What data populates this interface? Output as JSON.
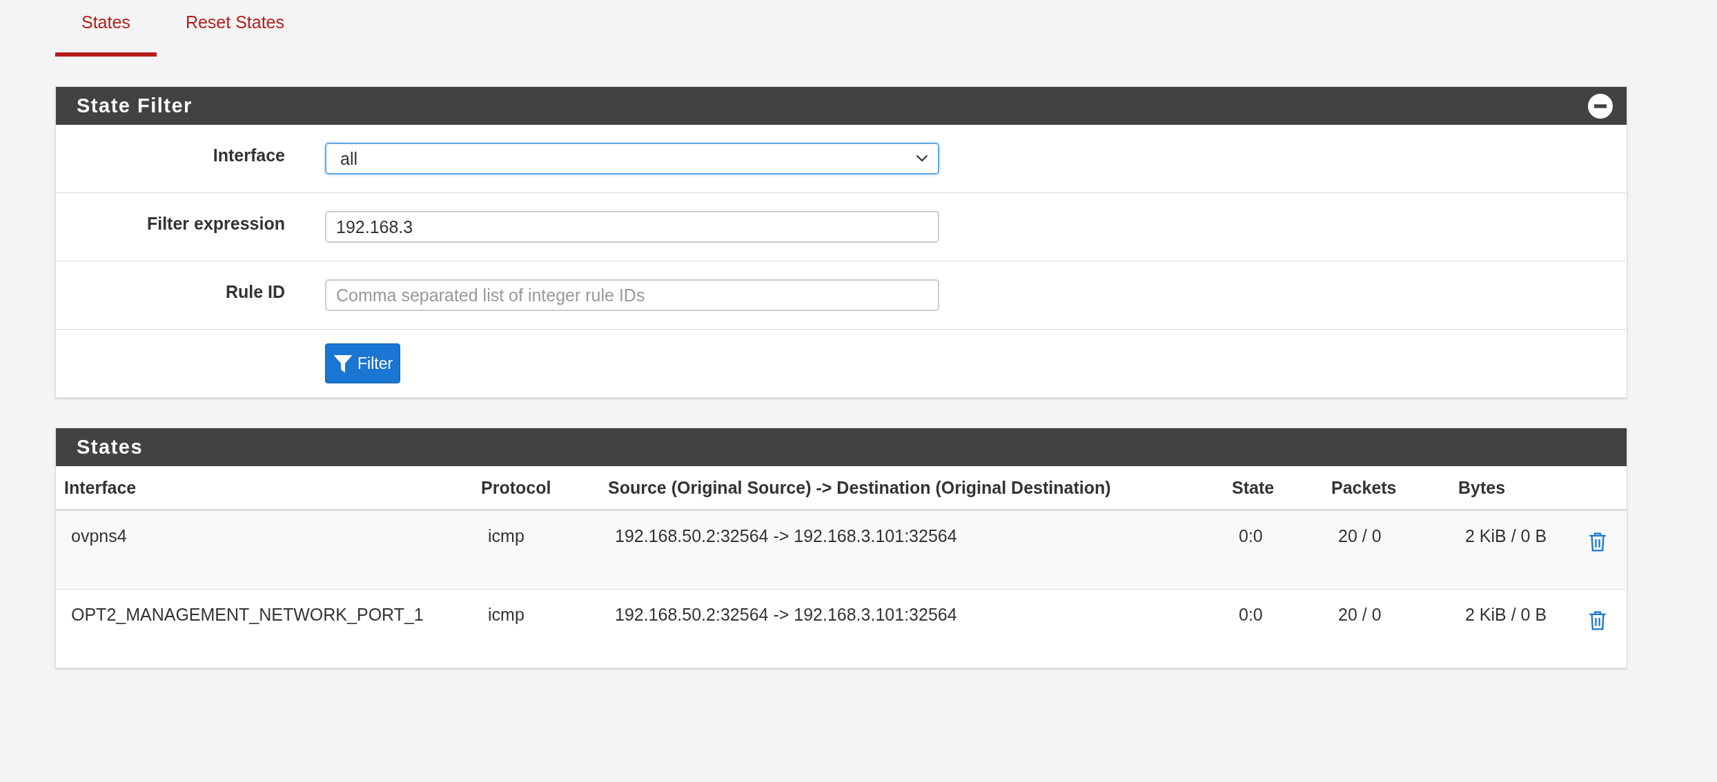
{
  "tabs": [
    {
      "label": "States",
      "selected": true
    },
    {
      "label": "Reset States",
      "selected": false
    }
  ],
  "filter_panel": {
    "title": "State Filter",
    "fields": [
      {
        "kind": "select",
        "label": "Interface",
        "value": "all"
      },
      {
        "kind": "text",
        "label": "Filter expression",
        "value": "192.168.3"
      },
      {
        "kind": "text",
        "label": "Rule ID",
        "placeholder": "Comma separated list of integer rule IDs"
      }
    ],
    "button": "Filter"
  },
  "states_panel": {
    "title": "States",
    "columns": [
      "Interface",
      "Protocol",
      "Source (Original Source) -> Destination (Original Destination)",
      "State",
      "Packets",
      "Bytes"
    ],
    "rows": [
      {
        "cells": [
          "ovpns4",
          "icmp",
          "192.168.50.2:32564 -> 192.168.3.101:32564",
          "0:0",
          "20 / 0",
          "2 KiB / 0 B"
        ]
      },
      {
        "cells": [
          "OPT2_MANAGEMENT_NETWORK_PORT_1",
          "icmp",
          "192.168.50.2:32564 -> 192.168.3.101:32564",
          "0:0",
          "20 / 0",
          "2 KiB / 0 B"
        ]
      }
    ]
  }
}
